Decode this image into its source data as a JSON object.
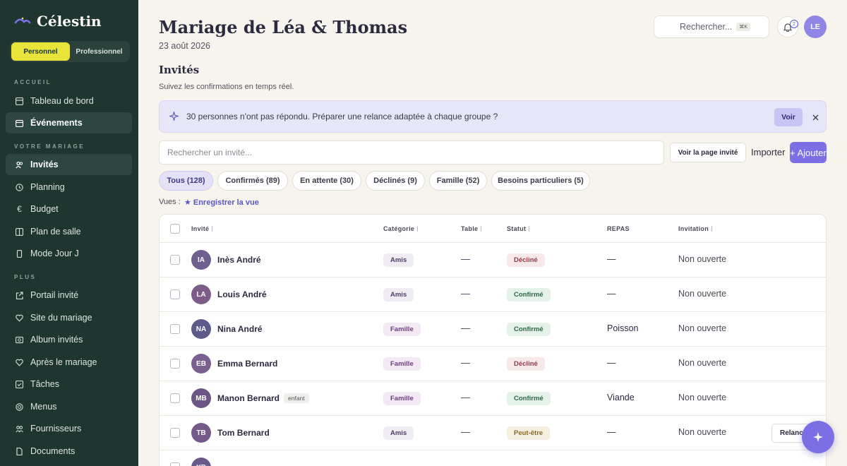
{
  "app": {
    "brand": "Célestin"
  },
  "sidebar": {
    "modes": [
      "Personnel",
      "Professionnel"
    ],
    "sections": {
      "accueil": "ACCUEIL",
      "mariage": "VOTRE MARIAGE",
      "plus": "PLUS"
    },
    "items": [
      {
        "label": "Tableau de bord",
        "icon": "grid-icon"
      },
      {
        "label": "Événements",
        "icon": "calendar-icon"
      },
      {
        "label": "Invités",
        "icon": "users-icon"
      },
      {
        "label": "Planning",
        "icon": "clock-icon"
      },
      {
        "label": "Budget",
        "icon": "euro-icon"
      },
      {
        "label": "Plan de salle",
        "icon": "layout-icon"
      },
      {
        "label": "Mode Jour J",
        "icon": "phone-icon"
      },
      {
        "label": "Portail invité",
        "icon": "share-icon"
      },
      {
        "label": "Site du mariage",
        "icon": "heart-icon"
      },
      {
        "label": "Album invités",
        "icon": "image-icon"
      },
      {
        "label": "Après le mariage",
        "icon": "heart-icon"
      },
      {
        "label": "Tâches",
        "icon": "check-square-icon"
      },
      {
        "label": "Menus",
        "icon": "dish-icon"
      },
      {
        "label": "Fournisseurs",
        "icon": "people-icon"
      },
      {
        "label": "Documents",
        "icon": "file-icon"
      }
    ]
  },
  "header": {
    "title": "Mariage de Léa & Thomas",
    "date": "23 août 2026",
    "search_placeholder": "Rechercher...",
    "search_shortcut": "⌘K",
    "notifications_count": "2",
    "user_initials": "LE"
  },
  "page": {
    "title": "Invités",
    "subtitle": "Suivez les confirmations en temps réel.",
    "banner_text": "30 personnes n'ont pas répondu. Préparer une relance adaptée à chaque groupe ?",
    "banner_action": "Voir",
    "guest_search_placeholder": "Rechercher un invité...",
    "voir_page_label": "Voir la page invité",
    "import_label": "Importer",
    "add_label": "+ Ajouter",
    "views_label": "Vues :",
    "save_view_label": "Enregistrer la vue"
  },
  "filters": [
    "Tous (128)",
    "Confirmés (89)",
    "En attente (30)",
    "Déclinés (9)",
    "Famille (52)",
    "Besoins particuliers (5)"
  ],
  "table": {
    "columns": [
      "Invité",
      "Catégorie",
      "Table",
      "Statut",
      "REPAS",
      "Invitation"
    ],
    "rows": [
      {
        "initials": "IA",
        "name": "Inès André",
        "tag": "",
        "category": "Amis",
        "table": "—",
        "status": "Décliné",
        "meal": "—",
        "invitation": "Non ouverte",
        "action": ""
      },
      {
        "initials": "LA",
        "name": "Louis André",
        "tag": "",
        "category": "Amis",
        "table": "—",
        "status": "Confirmé",
        "meal": "—",
        "invitation": "Non ouverte",
        "action": ""
      },
      {
        "initials": "NA",
        "name": "Nina André",
        "tag": "",
        "category": "Famille",
        "table": "—",
        "status": "Confirmé",
        "meal": "Poisson",
        "invitation": "Non ouverte",
        "action": ""
      },
      {
        "initials": "EB",
        "name": "Emma Bernard",
        "tag": "",
        "category": "Famille",
        "table": "—",
        "status": "Décliné",
        "meal": "—",
        "invitation": "Non ouverte",
        "action": ""
      },
      {
        "initials": "MB",
        "name": "Manon Bernard",
        "tag": "enfant",
        "category": "Famille",
        "table": "—",
        "status": "Confirmé",
        "meal": "Viande",
        "invitation": "Non ouverte",
        "action": ""
      },
      {
        "initials": "TB",
        "name": "Tom Bernard",
        "tag": "",
        "category": "Amis",
        "table": "—",
        "status": "Peut-être",
        "meal": "—",
        "invitation": "Non ouverte",
        "action": "Relancer"
      },
      {
        "initials": "YB",
        "name": "",
        "tag": "",
        "category": "",
        "table": "",
        "status": "",
        "meal": "",
        "invitation": "",
        "action": ""
      }
    ]
  },
  "colors": {
    "sidebar_bg": "#1f3530",
    "accent": "#7c6fe6",
    "mode_active": "#e8e43a",
    "page_bg": "#f7f4ee"
  }
}
